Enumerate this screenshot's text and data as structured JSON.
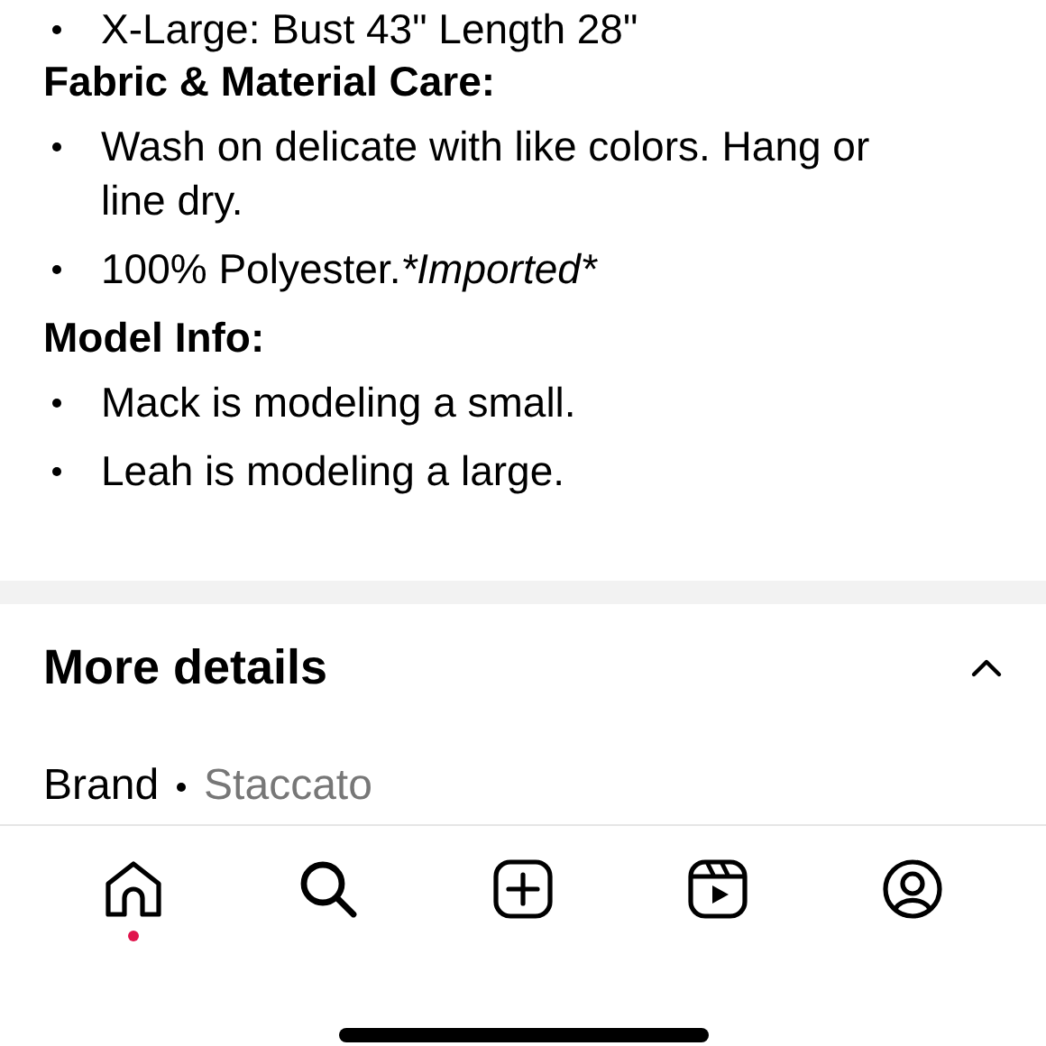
{
  "description": {
    "cut_line": "X-Large: Bust 43\" Length 28\"",
    "sections": [
      {
        "heading": "Fabric & Material Care:",
        "bullets": [
          {
            "text": "Wash on delicate with like colors. Hang or line dry."
          },
          {
            "text": "100% Polyester.",
            "note": "*Imported*"
          }
        ]
      },
      {
        "heading": "Model Info:",
        "bullets": [
          {
            "text": "Mack is modeling a small."
          },
          {
            "text": "Leah is modeling a large."
          }
        ]
      }
    ]
  },
  "more_details": {
    "title": "More details",
    "expanded": true,
    "rows": [
      {
        "label": "Brand",
        "value": "Staccato"
      }
    ]
  },
  "nav": [
    {
      "kind": "home",
      "selected": true
    },
    {
      "kind": "search",
      "selected": false
    },
    {
      "kind": "create",
      "selected": false
    },
    {
      "kind": "reels",
      "selected": false
    },
    {
      "kind": "profile",
      "selected": false
    }
  ]
}
